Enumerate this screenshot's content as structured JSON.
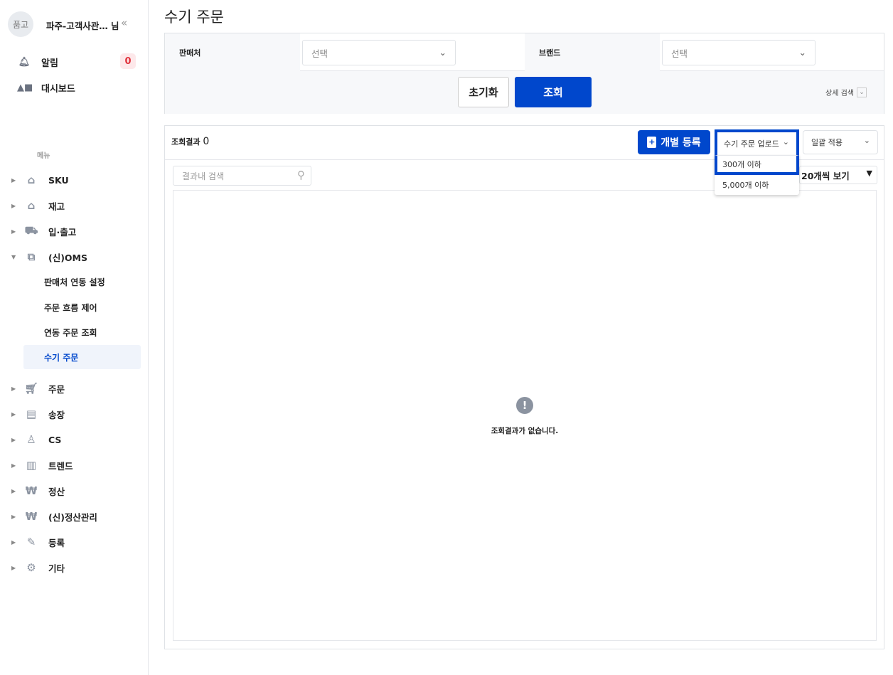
{
  "sidebar": {
    "avatar": "품고",
    "user": "파주-고객사관… 님",
    "alarm": "알림",
    "alarm_count": "0",
    "dashboard": "대시보드",
    "menu_heading": "메뉴",
    "items": [
      {
        "label": "SKU",
        "icon": "bag-icon"
      },
      {
        "label": "재고",
        "icon": "warehouse-icon"
      },
      {
        "label": "입·출고",
        "icon": "truck-icon"
      },
      {
        "label": "(신)OMS",
        "icon": "link-icon"
      },
      {
        "label": "주문",
        "icon": "cart-icon"
      },
      {
        "label": "송장",
        "icon": "invoice-icon"
      },
      {
        "label": "CS",
        "icon": "person-icon"
      },
      {
        "label": "트렌드",
        "icon": "chart-icon"
      },
      {
        "label": "정산",
        "icon": "won-icon"
      },
      {
        "label": "(신)정산관리",
        "icon": "won-icon"
      },
      {
        "label": "등록",
        "icon": "pencil-icon"
      },
      {
        "label": "기타",
        "icon": "gear-icon"
      }
    ],
    "oms_sub": [
      "판매처 연동 설정",
      "주문 흐름 제어",
      "연동 주문 조회",
      "수기 주문"
    ]
  },
  "page": {
    "title": "수기 주문"
  },
  "filter": {
    "seller_label": "판매처",
    "seller_placeholder": "선택",
    "brand_label": "브랜드",
    "brand_placeholder": "선택",
    "reset": "초기화",
    "search": "조회",
    "advanced": "상세 검색"
  },
  "results": {
    "count_label": "조회결과",
    "count": "0",
    "register": "개별 등록",
    "upload": "수기 주문 업로드",
    "upload_options": [
      "300개 이하",
      "5,000개 이하"
    ],
    "bulk": "일괄 적용",
    "search_placeholder": "결과내 검색",
    "per_page": "20개씩 보기",
    "empty": "조회결과가 없습니다."
  },
  "colors": {
    "accent": "#0047cc",
    "badge": "#e0323c"
  }
}
